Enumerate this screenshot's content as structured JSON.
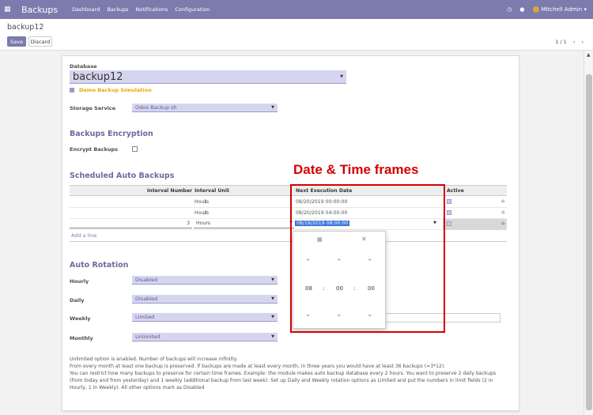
{
  "navbar": {
    "app_title": "Backups",
    "menu": [
      "Dashboard",
      "Backups",
      "Notifications",
      "Configuration"
    ],
    "user": "Mitchell Admin"
  },
  "control": {
    "breadcrumb": "backup12",
    "save": "Save",
    "discard": "Discard",
    "pager": "1 / 1"
  },
  "form": {
    "database_label": "Database",
    "database_value": "backup12",
    "demo_label": "Demo Backup Simulation",
    "storage_label": "Storage Service",
    "storage_value": "Odoo Backup sh",
    "encryption_heading": "Backups Encryption",
    "encrypt_label": "Encrypt Backups",
    "scheduled_heading": "Scheduled Auto Backups",
    "columns": [
      "Interval Number",
      "Interval Unit",
      "Next Execution Date",
      "Active"
    ],
    "rows": [
      {
        "number": "1",
        "unit": "Hours",
        "date": "08/20/2019 00:00:00"
      },
      {
        "number": "2",
        "unit": "Hours",
        "date": "08/20/2019 04:00:00"
      },
      {
        "number": "3",
        "unit": "Hours",
        "date": "08/19/2019 08:00:00"
      }
    ],
    "add_line": "Add a line",
    "rotation_heading": "Auto Rotation",
    "rotation": [
      {
        "label": "Hourly",
        "value": "Disabled"
      },
      {
        "label": "Daily",
        "value": "Disabled"
      },
      {
        "label": "Weekly",
        "value": "Limited"
      },
      {
        "label": "Monthly",
        "value": "Unlimited"
      }
    ],
    "note": "Unlimited option is enabled. Number of backups will increase infinitly.\nFrom every month at least one backup is preserved. If backups are made at least every month, in three years you would have at least 36 backups (=3*12).\nYou can restrict how many backups to preserve for certain time frames. Example: the module makes auto backup database every 2 hours. You want to preserve 2 daily backups (from today and from yesterday) and 1 weekly (additional backup from last week). Set up Daily and Weekly rotation options as Limited and put the numbers in limit fields (2 in Hourly, 1 in Weekly). All other options mark as Disabled"
  },
  "picker": {
    "hour": "08",
    "minute": "00",
    "second": "00",
    "sep": ":"
  },
  "annotation": {
    "title": "Date & Time frames",
    "color": "#d40000"
  },
  "colors": {
    "brand": "#7c7bad",
    "field_bg": "#d6d5f0",
    "demo": "#e8a800"
  }
}
